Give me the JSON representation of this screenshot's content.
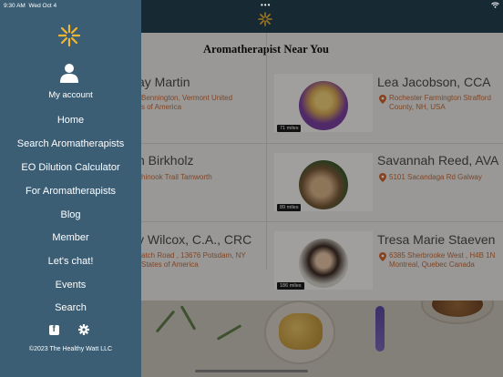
{
  "status": {
    "time": "9:30 AM",
    "date": "Wed Oct 4",
    "more_icon": "more-dots-icon",
    "wifi_icon": "wifi-icon"
  },
  "content": {
    "heading": "Aromatherapist Near You",
    "cards": [
      {
        "name": "ay Martin",
        "address": "Bennington, Vermont United\ns of America",
        "miles": ""
      },
      {
        "name": "Lea Jacobson, CCA",
        "address": "Rochester Farmington Strafford\nCounty, NH, USA",
        "miles": "71 miles"
      },
      {
        "name": "n Birkholz",
        "address": "hinook Trail Tamworth",
        "miles": ""
      },
      {
        "name": "Savannah Reed, AVA",
        "address": "5101 Sacandaga Rd Galway",
        "miles": "89 miles"
      },
      {
        "name": "y Wilcox, C.A., CRC",
        "address": "atch Road , 13676 Potsdam, NY\nStates of America",
        "miles": ""
      },
      {
        "name": "Tresa Marie Staeven",
        "address": "6385 Sherbrooke West , H4B 1N\nMontreal, Quebec Canada",
        "miles": "186 miles"
      }
    ]
  },
  "drawer": {
    "account_label": "My account",
    "menu": [
      "Home",
      "Search Aromatherapists",
      "EO Dilution Calculator",
      "For Aromatherapists",
      "Blog",
      "Member",
      "Let's chat!",
      "Events",
      "Search"
    ],
    "copyright": "©2023 The Healthy Watt LLC"
  },
  "colors": {
    "drawer": "#3b5e75",
    "header": "#24414f",
    "accent": "#c56b3a",
    "logo": "#f2b632"
  }
}
